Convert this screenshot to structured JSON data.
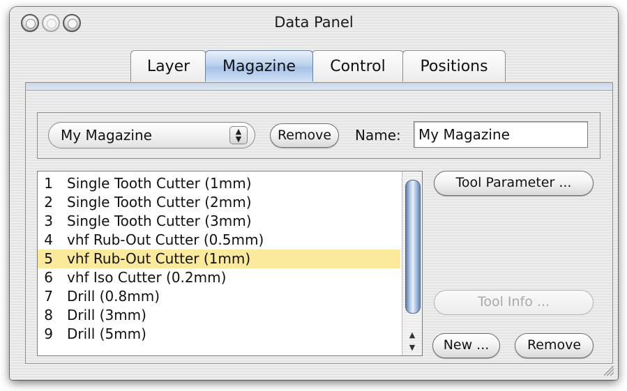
{
  "window": {
    "title": "Data Panel"
  },
  "tabs": [
    {
      "label": "Layer"
    },
    {
      "label": "Magazine"
    },
    {
      "label": "Control"
    },
    {
      "label": "Positions"
    }
  ],
  "magazine_bar": {
    "selected_magazine": "My Magazine",
    "remove_label": "Remove",
    "name_label": "Name:",
    "name_value": "My Magazine"
  },
  "tools": [
    {
      "num": "1",
      "name": "Single Tooth Cutter (1mm)"
    },
    {
      "num": "2",
      "name": "Single Tooth Cutter (2mm)"
    },
    {
      "num": "3",
      "name": "Single Tooth Cutter (3mm)"
    },
    {
      "num": "4",
      "name": "vhf Rub-Out Cutter (0.5mm)"
    },
    {
      "num": "5",
      "name": "vhf Rub-Out Cutter (1mm)"
    },
    {
      "num": "6",
      "name": "vhf Iso Cutter (0.2mm)"
    },
    {
      "num": "7",
      "name": "Drill (0.8mm)"
    },
    {
      "num": "8",
      "name": "Drill (3mm)"
    },
    {
      "num": "9",
      "name": "Drill (5mm)"
    }
  ],
  "selected_tool_index": 4,
  "buttons": {
    "tool_parameter": "Tool Parameter ...",
    "tool_info": "Tool Info ...",
    "new": "New ...",
    "remove": "Remove"
  },
  "colors": {
    "selection_highlight": "#fbe99c",
    "active_tab": "#bcd2ee",
    "scroll_thumb": "#7f9cc4"
  }
}
